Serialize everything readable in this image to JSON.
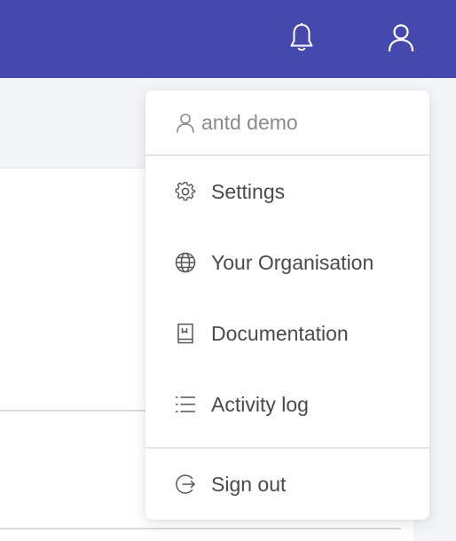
{
  "header": {
    "bg_color": "#4549ad",
    "icons": [
      "bell-icon",
      "user-icon"
    ]
  },
  "menu": {
    "username": "antd demo",
    "items": [
      {
        "label": "Settings",
        "icon": "gear-icon"
      },
      {
        "label": "Your Organisation",
        "icon": "globe-icon"
      },
      {
        "label": "Documentation",
        "icon": "book-icon"
      },
      {
        "label": "Activity log",
        "icon": "list-icon"
      }
    ],
    "signout": {
      "label": "Sign out",
      "icon": "logout-icon"
    }
  }
}
